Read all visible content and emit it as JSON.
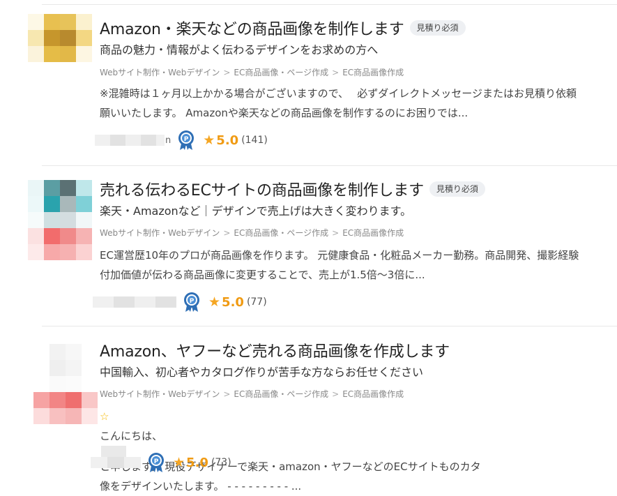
{
  "listings": [
    {
      "title": "Amazon・楽天などの商品画像を制作します",
      "badge": "見積り必須",
      "subtitle": "商品の魅力・情報がよく伝わるデザインをお求めの方へ",
      "breadcrumb": [
        "Webサイト制作・Webデザイン",
        "EC商品画像・ページ作成",
        "EC商品画像作成"
      ],
      "breadcrumb_sep": ">",
      "desc_line1": "※混雑時は１ヶ月以上かかる場合がございますので、　 必ずダイレクトメッセージまたはお見積り依頼",
      "desc_line2": "願いいたします。 Amazonや楽天などの商品画像を制作するのにお困りでは...",
      "rating_star": "★",
      "rating": "5.0",
      "review_count": "(141)",
      "seller_initial": "n"
    },
    {
      "title": "売れる伝わるECサイトの商品画像を制作します",
      "badge": "見積り必須",
      "subtitle": "楽天・Amazonなど｜デザインで売上げは大きく変わります。",
      "breadcrumb": [
        "Webサイト制作・Webデザイン",
        "EC商品画像・ページ作成",
        "EC商品画像作成"
      ],
      "breadcrumb_sep": ">",
      "desc_line1": "EC運営歴10年のプロが商品画像を作ります。 元健康食品・化粧品メーカー勤務。商品開発、撮影経験",
      "desc_line2": "付加価値が伝わる商品画像に変更することで、売上が1.5倍～3倍に...",
      "rating_star": "★",
      "rating": "5.0",
      "review_count": "(77)"
    },
    {
      "title": "Amazon、ヤフーなど売れる商品画像を作成します",
      "subtitle": "中国輸入、初心者やカタログ作りが苦手な方ならお任せください",
      "breadcrumb": [
        "Webサイト制作・Webデザイン",
        "EC商品画像・ページ作成",
        "EC商品画像作成"
      ],
      "breadcrumb_sep": ">",
      "desc_star": "☆",
      "desc_line1_a": "こんにちは、",
      "desc_line1_b": "と申します。 現役デザイナーで楽天・amazon・ヤフーなどのECサイトものカタ",
      "desc_line2": "像をデザインいたします。 - - - - - - - - - ...",
      "rating_star": "★",
      "rating": "5.0",
      "review_count": "(73)"
    }
  ],
  "colors": {
    "rating": "#f09b14",
    "badge_bg": "#eef0f3",
    "medal_blue": "#2f6fb5"
  },
  "icons": [
    "medal-badge-icon",
    "star-icon"
  ]
}
